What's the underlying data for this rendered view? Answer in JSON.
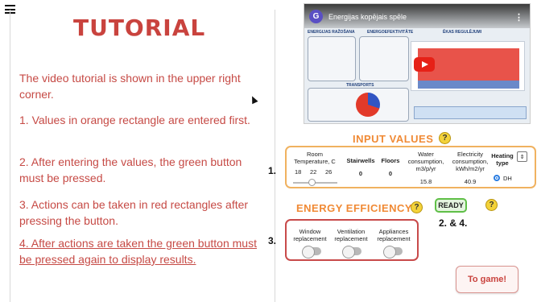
{
  "tutorial": {
    "title": "TUTORIAL",
    "paragraphs": [
      "The video tutorial is shown in the upper right corner.",
      "1. Values in orange rectangle are entered first.",
      "2. After entering the values, the green button must be pressed.",
      "3. Actions can be taken in red rectangles after pressing the button."
    ],
    "link_text": "4. After actions are taken the green button must be pressed again to display results."
  },
  "video": {
    "avatar_letter": "G",
    "title": "Energijas kopējais spēle",
    "section_left": "ENERGIJAS RAŽOŠANA",
    "section_mid": "ENERGOEFEKTIVITĀTE",
    "section_right": "ĒKAS REGULĒJUMI",
    "section_transport": "TRANSPORTS"
  },
  "input_values": {
    "title": "INPUT VALUES",
    "help": "?",
    "marker": "1.",
    "columns": {
      "room_temp": "Room Temperature, C",
      "stairwells": "Stairwells",
      "floors": "Floors",
      "water": "Water consumption, m3/p/yr",
      "electricity": "Electricity consumption, kWh/m2/yr",
      "heating": "Heating type"
    },
    "room_temp_values": [
      "18",
      "22",
      "26"
    ],
    "stairwells_value": "0",
    "floors_value": "0",
    "water_value": "15.8",
    "electricity_value": "40.9",
    "heating_option": "DH",
    "stepper": "⇕"
  },
  "ready": {
    "label": "READY",
    "help": "?",
    "marker": "2. & 4."
  },
  "energy_efficiency": {
    "title": "ENERGY EFFICIENCY",
    "help": "?",
    "marker": "3.",
    "items": [
      "Window replacement",
      "Ventilation replacement",
      "Appliances replacement"
    ]
  },
  "to_game": {
    "label": "To game!"
  },
  "colors": {
    "tutorial_red": "#c9433e",
    "input_orange": "#f0b260",
    "ready_green": "#5fbf47",
    "efficiency_red": "#c84a4a"
  }
}
